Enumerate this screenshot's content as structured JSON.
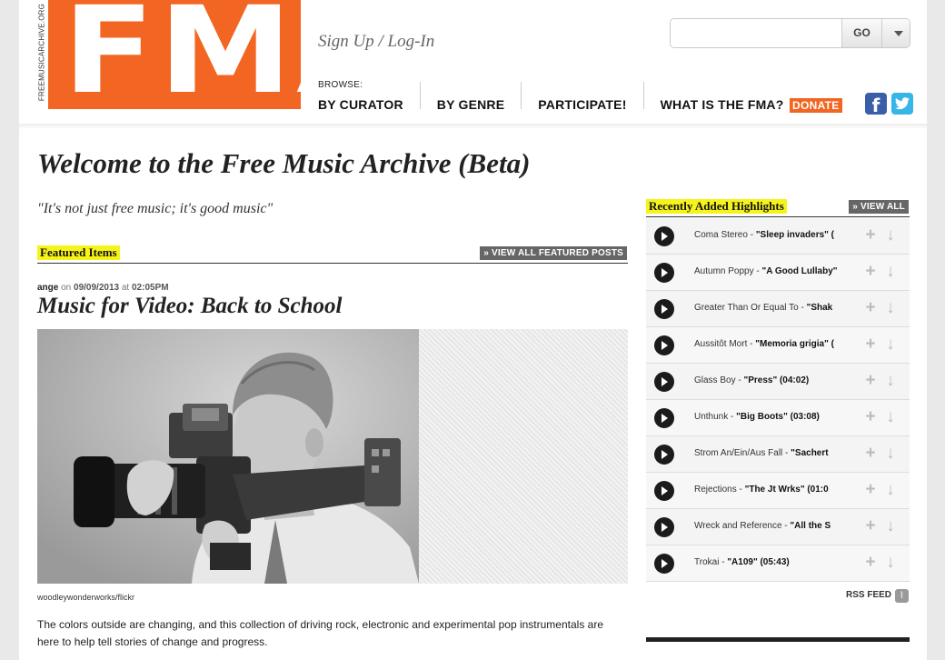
{
  "site": {
    "vertical_text": "FREEMUSICARCHIVE.ORG",
    "logo_text": "FMA",
    "signup": "Sign Up",
    "login": "Log-In",
    "separator": " / "
  },
  "search": {
    "placeholder": "",
    "value": "",
    "go_label": "GO"
  },
  "nav": {
    "browse_label": "BROWSE:",
    "items": [
      "BY CURATOR",
      "BY GENRE",
      "PARTICIPATE!",
      "WHAT IS THE FMA?"
    ],
    "donate_label": "DONATE"
  },
  "social": {
    "facebook_glyph": "f",
    "twitter_glyph": "t"
  },
  "main": {
    "title": "Welcome to the Free Music Archive (Beta)",
    "tagline": "\"It's not just free music; it's good music\"",
    "featured": {
      "heading": "Featured Items",
      "view_all": "» VIEW ALL FEATURED POSTS",
      "post": {
        "author": "ange",
        "on": " on ",
        "date": "09/09/2013",
        "at": " at ",
        "time": "02:05PM",
        "title": "Music for Video: Back to School",
        "image_credit": "woodleywonderworks/flickr",
        "body": "The colors outside are changing, and this collection of driving rock, electronic and experimental pop instrumentals are here to help tell stories of change and progress."
      }
    }
  },
  "sidebar": {
    "heading": "Recently Added Highlights",
    "view_all": "» VIEW ALL",
    "tracks": [
      {
        "artist": "Coma Stereo",
        "sep": " - ",
        "title": "\"Sleep invaders\" ("
      },
      {
        "artist": "Autumn Poppy",
        "sep": " - ",
        "title": "\"A Good Lullaby\""
      },
      {
        "artist": "Greater Than Or Equal To",
        "sep": " - ",
        "title": "\"Shak"
      },
      {
        "artist": "Aussitôt Mort",
        "sep": " - ",
        "title": "\"Memoria grigia\" ("
      },
      {
        "artist": "Glass Boy",
        "sep": " - ",
        "title": "\"Press\" (04:02)"
      },
      {
        "artist": "Unthunk",
        "sep": " - ",
        "title": "\"Big Boots\" (03:08)"
      },
      {
        "artist": "Strom An/Ein/Aus Fall",
        "sep": " - ",
        "title": "\"Sachert"
      },
      {
        "artist": "Rejections",
        "sep": " - ",
        "title": "\"The Jt Wrks\" (01:0"
      },
      {
        "artist": "Wreck and Reference",
        "sep": " - ",
        "title": "\"All the S"
      },
      {
        "artist": "Trokai",
        "sep": " - ",
        "title": "\"A109\" (05:43)"
      }
    ],
    "add_glyph": "+",
    "download_glyph": "↓",
    "rss_label": "RSS FEED",
    "rss_glyph": "⌇"
  },
  "colors": {
    "brand_orange": "#f26522",
    "highlight_yellow": "#f6f31a",
    "facebook_blue": "#3b5ea8",
    "twitter_blue": "#35b6e6"
  }
}
